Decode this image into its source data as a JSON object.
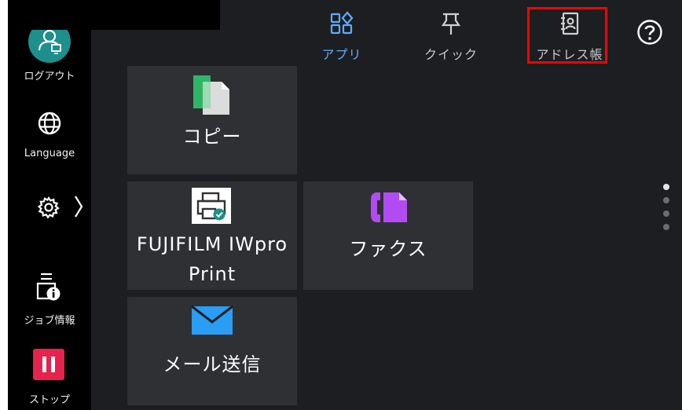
{
  "sidebar": {
    "logout_label": "ログアウト",
    "language_label": "Language",
    "job_label": "ジョブ情報",
    "stop_label": "ストップ"
  },
  "tabs": [
    {
      "label": "アプリ",
      "active": true,
      "icon": "apps-icon"
    },
    {
      "label": "クイック",
      "active": false,
      "icon": "pin-icon"
    },
    {
      "label": "アドレス帳",
      "active": false,
      "icon": "address-book-icon",
      "highlighted": true
    }
  ],
  "help_icon": "help-icon",
  "tiles": [
    {
      "label": "コピー",
      "icon": "copy-icon"
    },
    {
      "label_line1": "FUJIFILM IWpro",
      "label_line2": "Print",
      "icon": "printer-icon"
    },
    {
      "label": "ファクス",
      "icon": "fax-icon"
    },
    {
      "label": "メール送信",
      "icon": "mail-icon"
    }
  ],
  "pager": {
    "pages": 4,
    "current": 1
  },
  "colors": {
    "accent": "#5aaeff",
    "logout_avatar": "#1e8f8d",
    "stop": "#e5234d",
    "copy_green": "#2eb566",
    "fax_purple": "#b14cf2",
    "mail_blue": "#2a9df4",
    "highlight": "#ff0000"
  }
}
